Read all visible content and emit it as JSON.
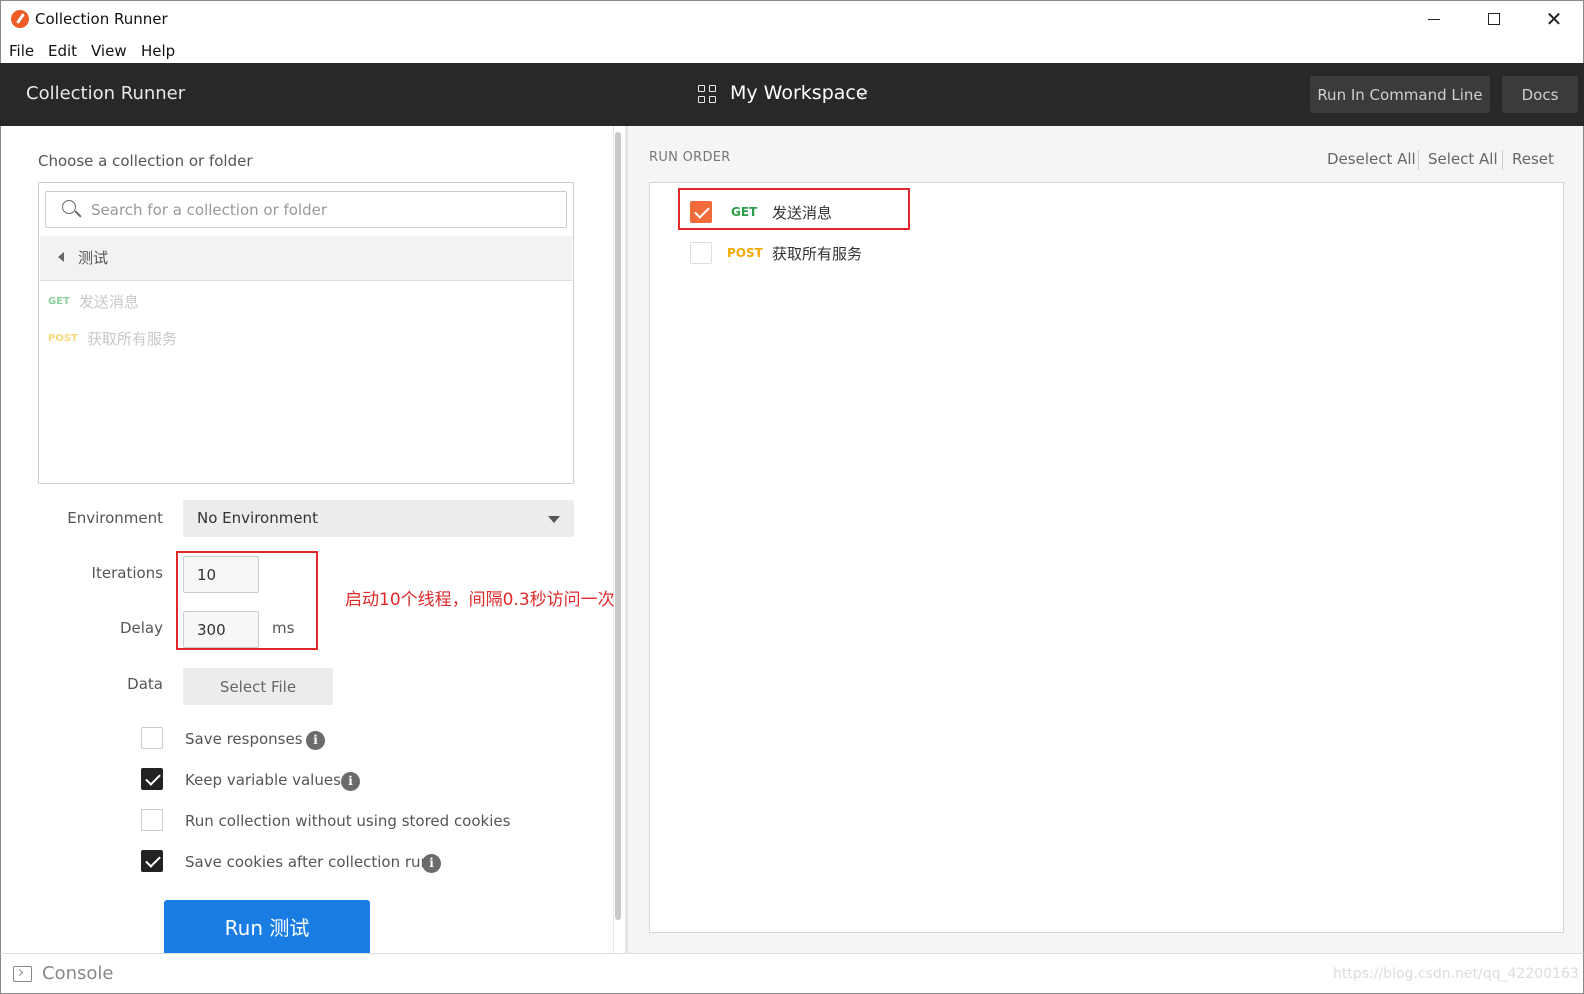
{
  "window": {
    "title": "Collection Runner",
    "min_icon": "minimize-icon",
    "max_icon": "maximize-icon",
    "close_glyph": "✕"
  },
  "menu": {
    "items": [
      "File",
      "Edit",
      "View",
      "Help"
    ]
  },
  "header": {
    "title": "Collection Runner",
    "workspace": "My Workspace",
    "cli_button": "Run In Command Line",
    "docs_button": "Docs"
  },
  "left": {
    "choose_label": "Choose a collection or folder",
    "search_placeholder": "Search for a collection or folder",
    "folder": "测试",
    "requests": [
      {
        "method": "GET",
        "name": "发送消息",
        "color": "#8fd19e"
      },
      {
        "method": "POST",
        "name": "获取所有服务",
        "color": "#f5d87a"
      }
    ],
    "environment_label": "Environment",
    "environment_value": "No Environment",
    "iterations_label": "Iterations",
    "iterations_value": "10",
    "delay_label": "Delay",
    "delay_value": "300",
    "delay_unit": "ms",
    "data_label": "Data",
    "select_file": "Select File",
    "annotation": "启动10个线程，间隔0.3秒访问一次",
    "options": [
      {
        "label": "Save responses",
        "checked": false,
        "info": true
      },
      {
        "label": "Keep variable values",
        "checked": true,
        "info": true
      },
      {
        "label": "Run collection without using stored cookies",
        "checked": false,
        "info": false
      },
      {
        "label": "Save cookies after collection run",
        "checked": true,
        "info": true
      }
    ],
    "info_glyph": "i",
    "run_button": "Run 测试"
  },
  "right": {
    "run_order_label": "RUN ORDER",
    "deselect_all": "Deselect All",
    "select_all": "Select All",
    "reset": "Reset",
    "items": [
      {
        "method": "GET",
        "name": "发送消息",
        "checked": true,
        "color": "#2e9e4a"
      },
      {
        "method": "POST",
        "name": "获取所有服务",
        "checked": false,
        "color": "#f2a900"
      }
    ]
  },
  "footer": {
    "console": "Console",
    "watermark": "https://blog.csdn.net/qq_42200163"
  },
  "colors": {
    "accent": "#1a7de4",
    "checked_orange": "#f26b3a",
    "annotation_red": "#e02a2a",
    "header_bg": "#282828"
  }
}
